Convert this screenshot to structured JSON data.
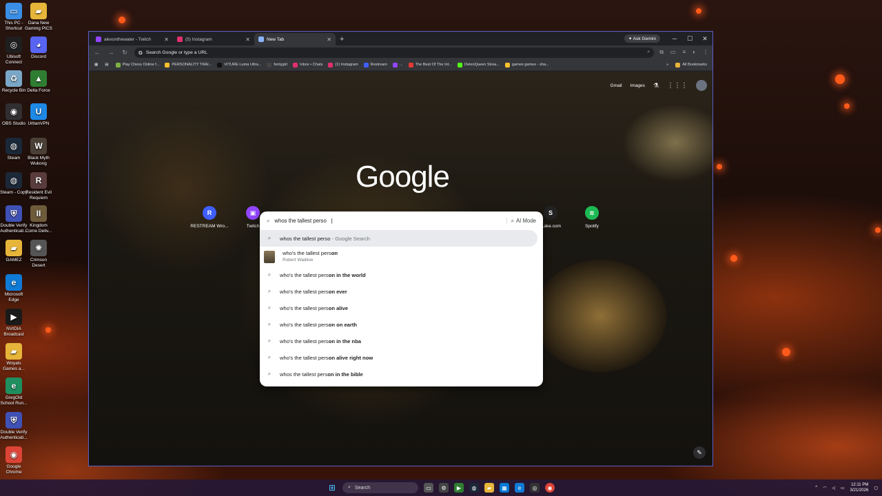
{
  "desktop": {
    "icons": [
      {
        "label": "This PC - Shortcut",
        "name": "this-pc-icon",
        "color": "#3a8ee6",
        "glyph": "▭"
      },
      {
        "label": "Dana New Gaming PICS",
        "name": "folder-icon",
        "color": "#e6b53a",
        "glyph": "▰"
      },
      {
        "label": "Ubisoft Connect",
        "name": "ubisoft-icon",
        "color": "#1f1f1f",
        "glyph": "◎"
      },
      {
        "label": "Discord",
        "name": "discord-icon",
        "color": "#5865f2",
        "glyph": "◕"
      },
      {
        "label": "Recycle Bin",
        "name": "recycle-bin-icon",
        "color": "#7aa7c7",
        "glyph": "♻"
      },
      {
        "label": "Delta Force",
        "name": "delta-force-icon",
        "color": "#2f7d32",
        "glyph": "▲"
      },
      {
        "label": "OBS Studio",
        "name": "obs-icon",
        "color": "#302e31",
        "glyph": "◉"
      },
      {
        "label": "UrbanVPN",
        "name": "urbanvpn-icon",
        "color": "#1e88e5",
        "glyph": "U"
      },
      {
        "label": "Steam",
        "name": "steam-icon",
        "color": "#1b2838",
        "glyph": "◍"
      },
      {
        "label": "Black Myth Wukong",
        "name": "black-myth-icon",
        "color": "#4a4036",
        "glyph": "W"
      },
      {
        "label": "Steam - Copy",
        "name": "steam-copy-icon",
        "color": "#1b2838",
        "glyph": "◍"
      },
      {
        "label": "Resident Evil Requiem",
        "name": "resident-evil-icon",
        "color": "#5a3c3c",
        "glyph": "R"
      },
      {
        "label": "Double Verify Authenticati...",
        "name": "double-verify-icon",
        "color": "#3f51b5",
        "glyph": "⛨"
      },
      {
        "label": "Kingdom Come Deliv...",
        "name": "kingdom-come-icon",
        "color": "#6d5b3a",
        "glyph": "II"
      },
      {
        "label": "GAMEZ",
        "name": "gamez-folder-icon",
        "color": "#e6b53a",
        "glyph": "▰"
      },
      {
        "label": "Crimson Desert",
        "name": "crimson-desert-icon",
        "color": "#555",
        "glyph": "✺"
      },
      {
        "label": "Microsoft Edge",
        "name": "edge-icon",
        "color": "#0f7bd6",
        "glyph": "e"
      },
      {
        "label": "NVIDIA Broadcast",
        "name": "nvidia-icon",
        "color": "#1a1a1a",
        "glyph": "▶"
      },
      {
        "label": "Woyals Games a...",
        "name": "woyals-folder-icon",
        "color": "#e6b53a",
        "glyph": "▰"
      },
      {
        "label": "GregOld School Run...",
        "name": "edge-dev-icon",
        "color": "#1f8f5f",
        "glyph": "e"
      },
      {
        "label": "Double Verify Authenticati...",
        "name": "double-verify-2-icon",
        "color": "#3f51b5",
        "glyph": "⛨"
      },
      {
        "label": "Google Chrome",
        "name": "chrome-desktop-icon",
        "color": "#db4437",
        "glyph": "◉"
      }
    ]
  },
  "browser": {
    "tabs": [
      {
        "label": "alexonthewater - Twitch",
        "fav": "#9146ff",
        "name": "tab-twitch",
        "active": false
      },
      {
        "label": "(5) Instagram",
        "fav": "#e1306c",
        "name": "tab-instagram",
        "active": false
      },
      {
        "label": "New Tab",
        "fav": "#8ab4f8",
        "name": "tab-new-tab",
        "active": true
      }
    ],
    "new_tab_glyph": "+",
    "ask_gemini": "Ask Gemini",
    "omnibox_placeholder": "Search Google or type a URL",
    "bookmarks": [
      {
        "label": "Play Chess Online f...",
        "fav": "#7cb342"
      },
      {
        "label": "PERSONALITY TRAI...",
        "fav": "#fbc02d"
      },
      {
        "label": "VITURE Luma Ultra...",
        "fav": "#111"
      },
      {
        "label": "fentygirl",
        "fav": "#444"
      },
      {
        "label": "Inbox • Chats",
        "fav": "#e1306c"
      },
      {
        "label": "(1) Instagram",
        "fav": "#e1306c"
      },
      {
        "label": "Restream",
        "fav": "#3f5efb"
      },
      {
        "label": "...",
        "fav": "#9146ff"
      },
      {
        "label": "The Best Of The Int...",
        "fav": "#e53935"
      },
      {
        "label": "DelenQueen Strea...",
        "fav": "#53fc18"
      },
      {
        "label": "games games - sha...",
        "fav": "#fbc02d"
      }
    ],
    "all_bookmarks": "All Bookmarks"
  },
  "ntp": {
    "gmail": "Gmail",
    "images": "Images",
    "logo": "Google",
    "shortcuts": [
      {
        "label": "RESTREAM Wro...",
        "glyph": "R",
        "color": "#3f5efb",
        "name": "shortcut-restream"
      },
      {
        "label": "Twitch",
        "glyph": "▣",
        "color": "#9146ff",
        "name": "shortcut-twitch"
      },
      {
        "label": "Spotify",
        "glyph": "≋",
        "color": "#1db954",
        "name": "shortcut-spotify"
      },
      {
        "label": "...ake.com",
        "glyph": "S",
        "color": "#222",
        "name": "shortcut-stake"
      }
    ]
  },
  "search": {
    "query": "whos the tallest perso",
    "ai_mode": "AI Mode",
    "suggestions": [
      {
        "type": "google",
        "plain": "whos the tallest perso",
        "bold": "",
        "suffix": " - Google Search"
      },
      {
        "type": "entity",
        "plain": "who's the tallest pers",
        "bold": "on",
        "sub": "Robert Wadlow"
      },
      {
        "type": "normal",
        "plain": "who's the tallest pers",
        "bold": "on in the world"
      },
      {
        "type": "normal",
        "plain": "who's the tallest pers",
        "bold": "on ever"
      },
      {
        "type": "normal",
        "plain": "who's the tallest pers",
        "bold": "on alive"
      },
      {
        "type": "normal",
        "plain": "who's the tallest pers",
        "bold": "on on earth"
      },
      {
        "type": "normal",
        "plain": "who's the tallest pers",
        "bold": "on in the nba"
      },
      {
        "type": "normal",
        "plain": "who's the tallest pers",
        "bold": "on alive right now"
      },
      {
        "type": "normal",
        "plain": "whos the tallest pers",
        "bold": "on in the bible"
      }
    ]
  },
  "taskbar": {
    "search_label": "Search",
    "time": "12:11 PM",
    "date": "3/21/2026"
  }
}
